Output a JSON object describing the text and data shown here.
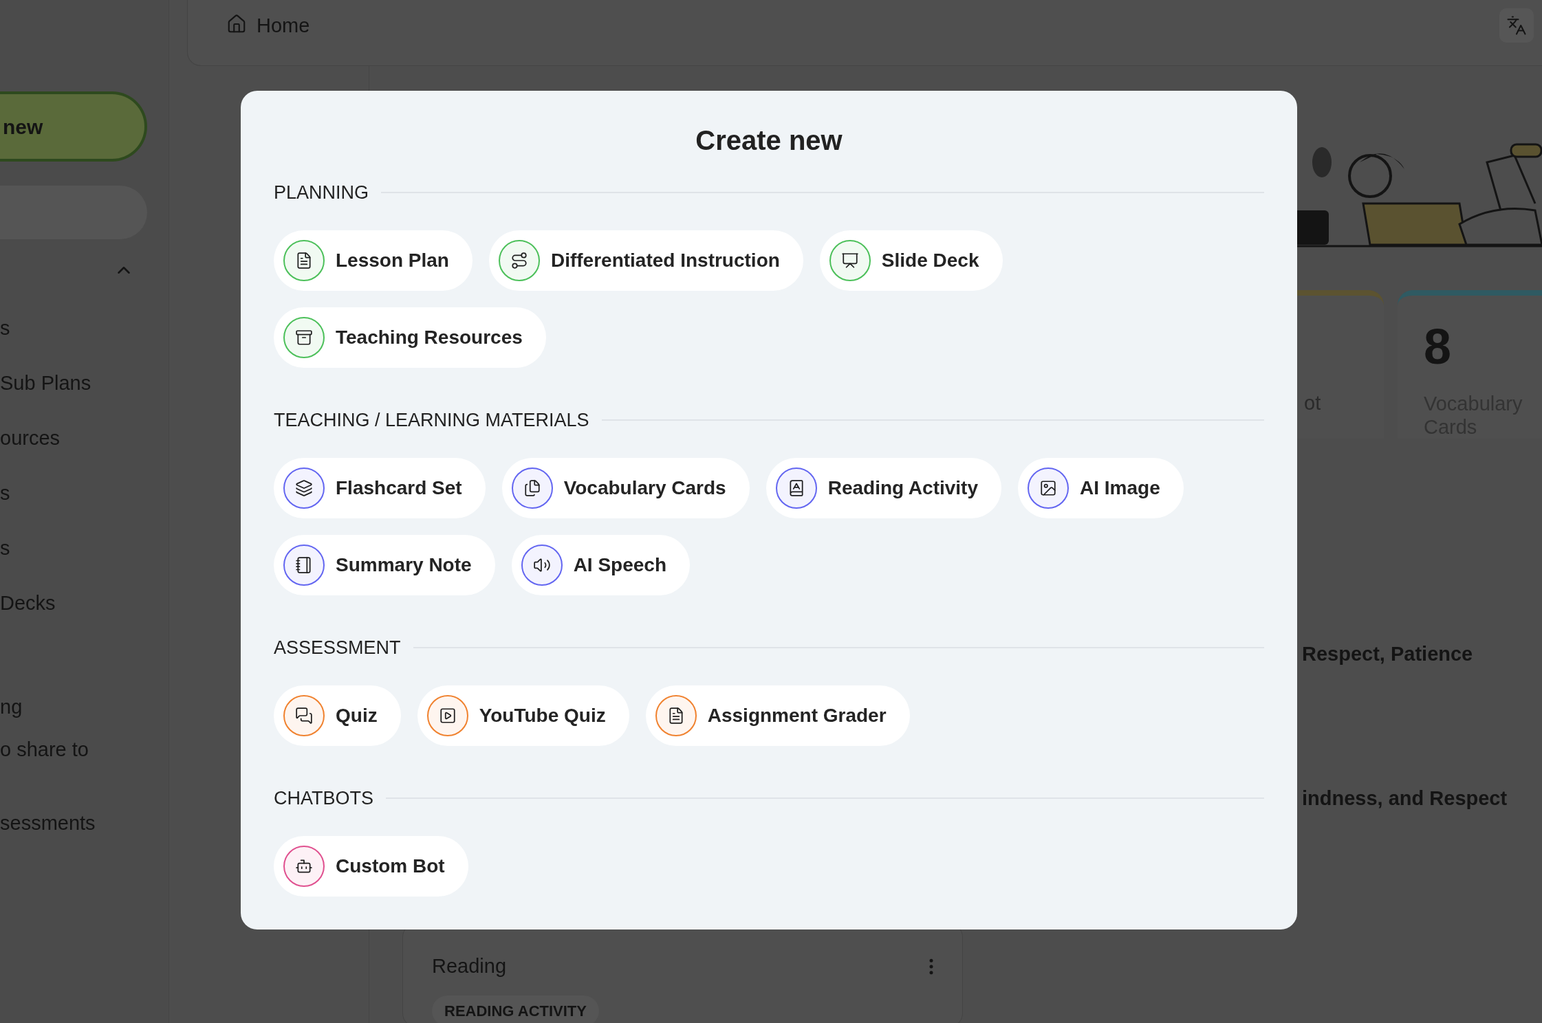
{
  "sidebar": {
    "new_button": "new",
    "group_expanded": true,
    "sections": [
      {
        "items": [
          "s",
          "Sub Plans",
          "ources",
          "s",
          "s",
          "Decks"
        ]
      },
      {
        "items": [
          "ng",
          "o share to"
        ]
      },
      {
        "items": [
          "sessments"
        ]
      }
    ]
  },
  "topbar": {
    "breadcrumb": "Home"
  },
  "dashboard": {
    "cards": [
      {
        "label": "ot",
        "color": "#5c5330"
      },
      {
        "count": "8",
        "label": "Vocabulary Cards",
        "color": "#2f5a62"
      }
    ],
    "lines": [
      "Respect, Patience",
      "indness, and Respect"
    ],
    "activity": {
      "title": "Reading",
      "tag": "READING ACTIVITY"
    }
  },
  "modal": {
    "title": "Create new",
    "sections": [
      {
        "heading": "PLANNING",
        "color": "#4cc05a",
        "items": [
          "Lesson Plan",
          "Differentiated Instruction",
          "Slide Deck",
          "Teaching Resources"
        ]
      },
      {
        "heading": "TEACHING / LEARNING MATERIALS",
        "color": "#6366f1",
        "items": [
          "Flashcard Set",
          "Vocabulary Cards",
          "Reading Activity",
          "AI Image",
          "Summary Note",
          "AI Speech"
        ]
      },
      {
        "heading": "ASSESSMENT",
        "color": "#f0822f",
        "items": [
          "Quiz",
          "YouTube Quiz",
          "Assignment Grader"
        ]
      },
      {
        "heading": "CHATBOTS",
        "color": "#e0508f",
        "items": [
          "Custom Bot"
        ]
      }
    ]
  }
}
